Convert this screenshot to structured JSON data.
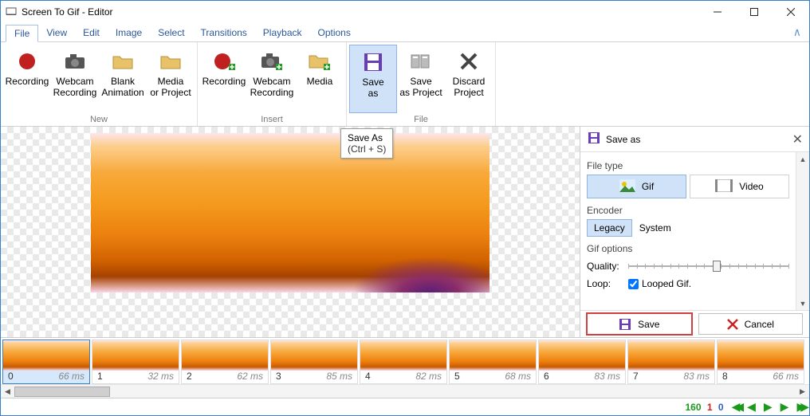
{
  "window": {
    "title": "Screen To Gif - Editor"
  },
  "menu": {
    "tabs": [
      "File",
      "View",
      "Edit",
      "Image",
      "Select",
      "Transitions",
      "Playback",
      "Options"
    ],
    "active": 0
  },
  "ribbon": {
    "groups": [
      {
        "label": "New",
        "buttons": [
          {
            "name": "recording-button",
            "label": "Recording",
            "icon": "record-red"
          },
          {
            "name": "webcam-recording-button",
            "label": "Webcam Recording",
            "icon": "camera"
          },
          {
            "name": "blank-animation-button",
            "label": "Blank Animation",
            "icon": "folder"
          },
          {
            "name": "media-or-project-button",
            "label": "Media or Project",
            "icon": "folder"
          }
        ]
      },
      {
        "label": "Insert",
        "buttons": [
          {
            "name": "insert-recording-button",
            "label": "Recording",
            "icon": "record-red-plus"
          },
          {
            "name": "insert-webcam-button",
            "label": "Webcam Recording",
            "icon": "camera-plus"
          },
          {
            "name": "insert-media-button",
            "label": "Media",
            "icon": "folder-plus"
          }
        ]
      },
      {
        "label": "File",
        "buttons": [
          {
            "name": "save-as-button",
            "label": "Save as",
            "icon": "floppy-purple",
            "highlighted": true
          },
          {
            "name": "save-as-project-button",
            "label": "Save as Project",
            "icon": "project"
          },
          {
            "name": "discard-project-button",
            "label": "Discard Project",
            "icon": "x-dark"
          }
        ]
      }
    ]
  },
  "tooltip": {
    "title": "Save As",
    "shortcut": "(Ctrl + S)"
  },
  "side": {
    "title": "Save as",
    "filetype_label": "File type",
    "filetypes": [
      {
        "label": "Gif",
        "selected": true
      },
      {
        "label": "Video",
        "selected": false
      }
    ],
    "encoder_label": "Encoder",
    "encoders": [
      {
        "label": "Legacy",
        "selected": true
      },
      {
        "label": "System",
        "selected": false
      }
    ],
    "options_label": "Gif options",
    "quality_label": "Quality:",
    "quality_value": 55,
    "loop_label": "Loop:",
    "loop_checkbox_label": "Looped Gif.",
    "loop_checked": true,
    "save_label": "Save",
    "cancel_label": "Cancel"
  },
  "frames": [
    {
      "index": 0,
      "duration": "66 ms",
      "selected": true
    },
    {
      "index": 1,
      "duration": "32 ms"
    },
    {
      "index": 2,
      "duration": "62 ms"
    },
    {
      "index": 3,
      "duration": "85 ms"
    },
    {
      "index": 4,
      "duration": "82 ms"
    },
    {
      "index": 5,
      "duration": "68 ms"
    },
    {
      "index": 6,
      "duration": "83 ms"
    },
    {
      "index": 7,
      "duration": "83 ms"
    },
    {
      "index": 8,
      "duration": "66 ms"
    }
  ],
  "status": {
    "count_a": 160,
    "count_b": 1,
    "count_c": 0
  },
  "colors": {
    "accent": "#3a80c8",
    "highlight_bg": "#cfe2f8",
    "purple": "#6a3db5",
    "red": "#d02a2a",
    "green": "#1a9a1a",
    "blue": "#2a62c8"
  }
}
